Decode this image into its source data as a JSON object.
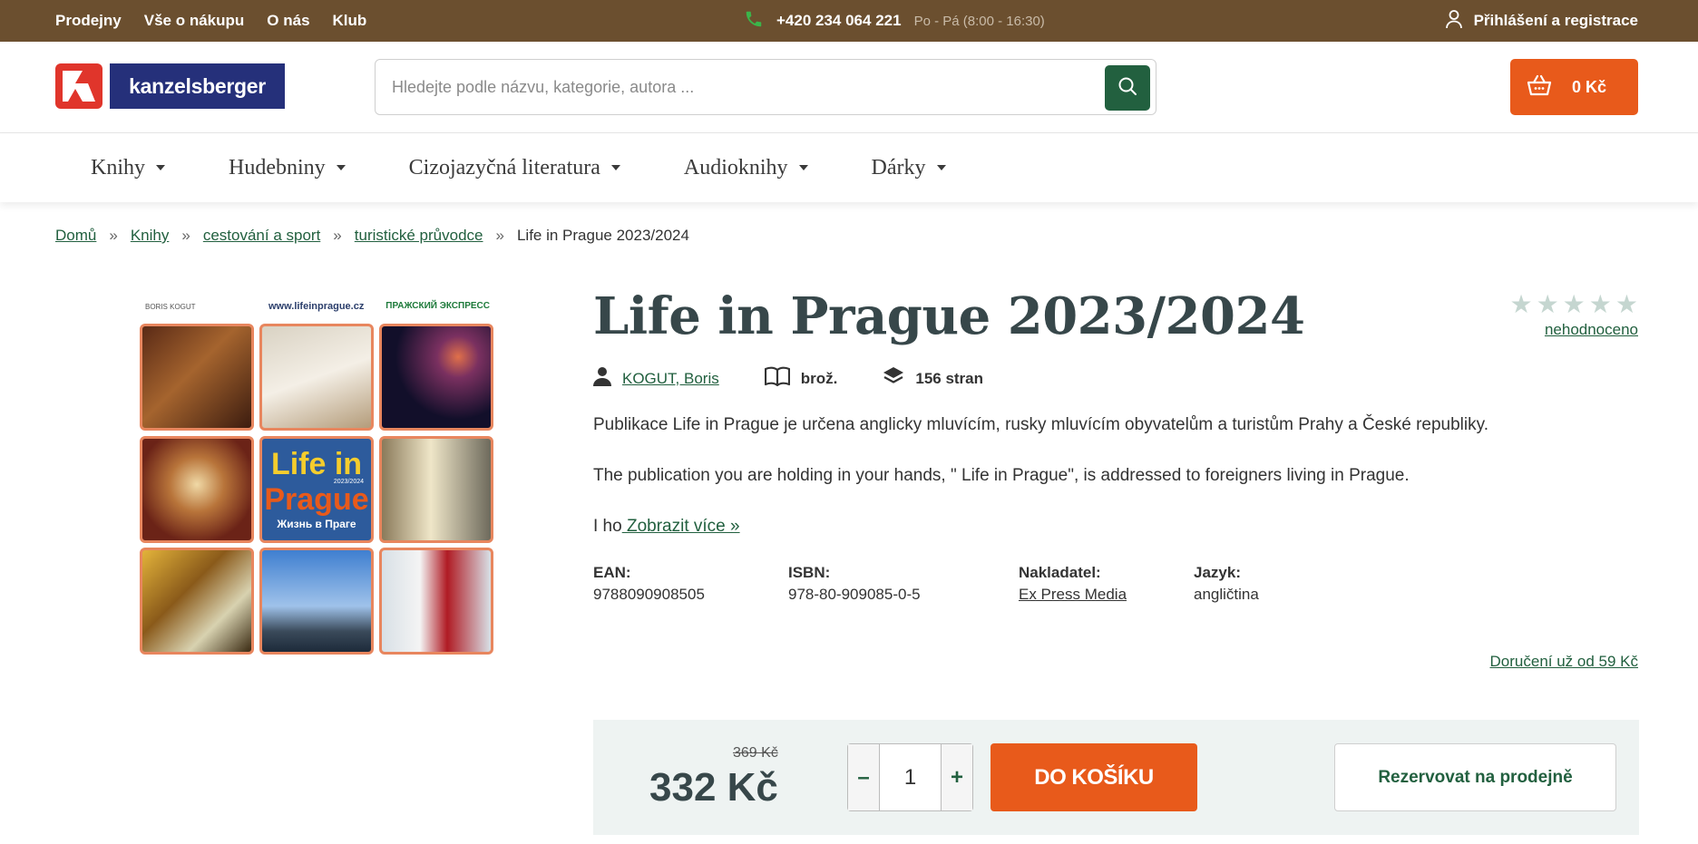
{
  "topbar": {
    "links": [
      "Prodejny",
      "Vše o nákupu",
      "O nás",
      "Klub"
    ],
    "phone": "+420 234 064 221",
    "hours": "Po - Pá (8:00 - 16:30)",
    "login": "Přihlášení a registrace",
    "icons": {
      "phone": "phone-icon",
      "login": "user-icon"
    }
  },
  "header": {
    "logo_text": "kanzelsberger",
    "search_placeholder": "Hledejte podle názvu, kategorie, autora ...",
    "cart_label": "0 Kč",
    "colors": {
      "brand_red": "#e0352b",
      "brand_blue": "#25307a",
      "accent_green": "#22603f",
      "accent_orange": "#e85a1b",
      "topbar": "#6b4f2f"
    }
  },
  "nav": {
    "items": [
      "Knihy",
      "Hudebniny",
      "Cizojazyčná literatura",
      "Audioknihy",
      "Dárky"
    ]
  },
  "breadcrumb": {
    "items": [
      "Domů",
      "Knihy",
      "cestování a sport",
      "turistické průvodce"
    ],
    "current": "Life in Prague 2023/2024",
    "separator": "»"
  },
  "cover": {
    "author_small": "BORIS KOGUT",
    "url": "www.lifeinprague.cz",
    "publisher_small": "ПРАЖСКИЙ ЭКСПРЕСС",
    "title_line1": "Life in",
    "title_line2": "Prague",
    "year": "2023/2024",
    "subtitle_ru": "Жизнь в Праге"
  },
  "product": {
    "title": "Life in Prague 2023/2024",
    "rating_label": "nehodnoceno",
    "rating_value": 0,
    "rating_max": 5,
    "author": "KOGUT, Boris",
    "binding": "brož.",
    "pages": "156 stran",
    "desc1": "Publikace Life in Prague je určena anglicky mluvícím, rusky mluvícím obyvatelům a turistům Prahy a České republiky.",
    "desc2": "The publication you are holding in your hands, \" Life in Prague\", is addressed to foreigners living in Prague.",
    "desc3": "I ho",
    "show_more": " Zobrazit více »",
    "specs": {
      "ean_label": "EAN:",
      "ean": "9788090908505",
      "isbn_label": "ISBN:",
      "isbn": "978-80-909085-0-5",
      "publisher_label": "Nakladatel:",
      "publisher": "Ex Press Media",
      "language_label": "Jazyk:",
      "language": "angličtina"
    },
    "delivery": "Doručení už od 59 Kč"
  },
  "buy": {
    "old_price": "369 Kč",
    "price": "332 Kč",
    "quantity": "1",
    "minus": "–",
    "plus": "+",
    "add_to_cart": "DO KOŠÍKU",
    "reserve": "Rezervovat na prodejně"
  }
}
